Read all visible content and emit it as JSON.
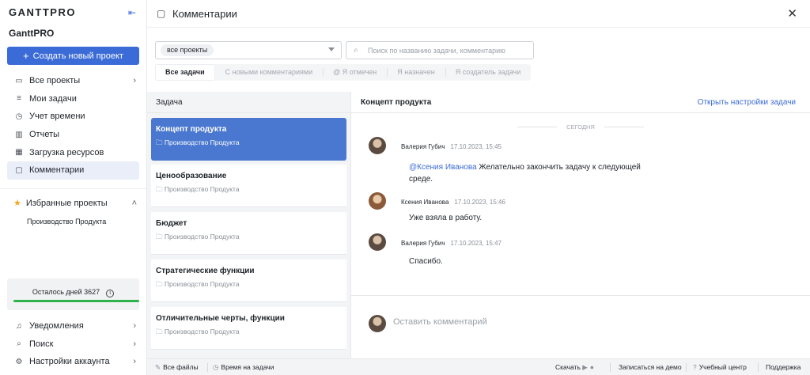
{
  "sidebar": {
    "logo": "GANTTPRO",
    "workspace": "GanttPRO",
    "create_button": "Создать новый проект",
    "items": [
      {
        "label": "Все проекты",
        "icon": "folder-icon"
      },
      {
        "label": "Мои задачи",
        "icon": "list-icon"
      },
      {
        "label": "Учет времени",
        "icon": "clock-icon"
      },
      {
        "label": "Отчеты",
        "icon": "report-icon"
      },
      {
        "label": "Загрузка ресурсов",
        "icon": "resources-icon"
      },
      {
        "label": "Комментарии",
        "icon": "comment-icon"
      }
    ],
    "favorites_label": "Избранные проекты",
    "favorite_project": "Производство Продукта",
    "trial_text": "Осталось дней 3627",
    "bottom_items": [
      {
        "label": "Уведомления",
        "icon": "bell-icon"
      },
      {
        "label": "Поиск",
        "icon": "search-icon"
      },
      {
        "label": "Настройки аккаунта",
        "icon": "gear-icon"
      }
    ]
  },
  "header": {
    "title": "Комментарии"
  },
  "filters": {
    "project_filter": "все проекты",
    "search_placeholder": "Поиск по названию задачи, комментарию",
    "tabs": [
      "Все задачи",
      "С новыми комментариями",
      "@ Я отмечен",
      "Я назначен",
      "Я создатель задачи"
    ]
  },
  "tasks": {
    "column": "Задача",
    "items": [
      {
        "name": "Концепт продукта",
        "project": "Производство Продукта"
      },
      {
        "name": "Ценообразование",
        "project": "Производство Продукта"
      },
      {
        "name": "Бюджет",
        "project": "Производство Продукта"
      },
      {
        "name": "Стратегические функции",
        "project": "Производство Продукта"
      },
      {
        "name": "Отличительные черты, функции",
        "project": "Производство Продукта"
      }
    ]
  },
  "conversation": {
    "title": "Концепт продукта",
    "settings_link": "Открыть настройки задачи",
    "day": "СЕГОДНЯ",
    "messages": [
      {
        "author": "Валерия Губич",
        "time": "17.10.2023, 15:45",
        "mention": "@Ксения   Иванова",
        "text": " Желательно закончить задачу к следующей среде."
      },
      {
        "author": "Ксения Иванова",
        "time": "17.10.2023, 15:46",
        "text": "Уже взяла в работу."
      },
      {
        "author": "Валерия Губич",
        "time": "17.10.2023, 15:47",
        "text": "Спасибо."
      }
    ],
    "compose_placeholder": "Оставить комментарий"
  },
  "footer": {
    "all_files": "Все файлы",
    "time_on_task": "Время на задачи",
    "download": "Скачать",
    "demo": "Записаться на демо",
    "learning": "Учебный центр",
    "support": "Поддержка"
  }
}
